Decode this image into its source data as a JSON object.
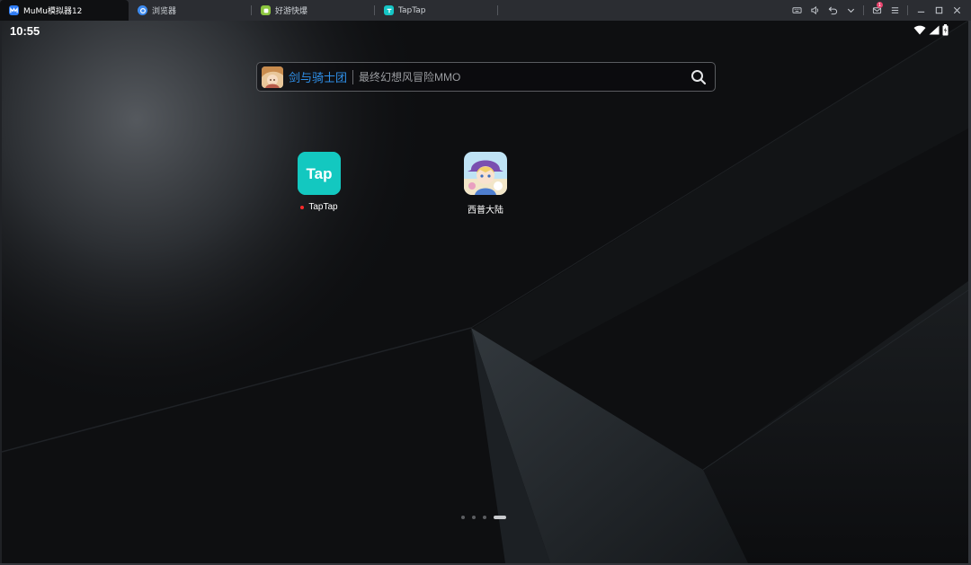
{
  "tabs": [
    {
      "label": "MuMu模拟器12",
      "icon": "mumu-icon",
      "color": "#2e7cf6",
      "active": true
    },
    {
      "label": "浏览器",
      "icon": "browser-icon",
      "color": "#3d8bf0",
      "active": false
    },
    {
      "label": "好游快爆",
      "icon": "haoyou-icon",
      "color": "#8cc63f",
      "active": false
    },
    {
      "label": "TapTap",
      "icon": "taptap-icon",
      "color": "#15c5c5",
      "active": false
    }
  ],
  "window_controls": {
    "icons": [
      "keyboard-icon",
      "volume-icon",
      "back-icon",
      "chevron-down-icon",
      "mail-icon",
      "menu-icon",
      "minimize-icon",
      "maximize-icon",
      "close-icon"
    ],
    "mail_badge": "1"
  },
  "status": {
    "time": "10:55",
    "icons": [
      "wifi-icon",
      "signal-icon",
      "battery-icon"
    ]
  },
  "search": {
    "game_name": "剑与骑士团",
    "hint": "最终幻想风冒险MMO",
    "accent": "#2f8fe8"
  },
  "apps": [
    {
      "label": "TapTap",
      "icon": "taptap-app-icon",
      "color": "#13c8c0",
      "badge": "new"
    },
    {
      "label": "西普大陆",
      "icon": "xipu-app-icon",
      "color": "#c8b2e6"
    }
  ],
  "pager": {
    "pages": 4,
    "active": 4
  }
}
